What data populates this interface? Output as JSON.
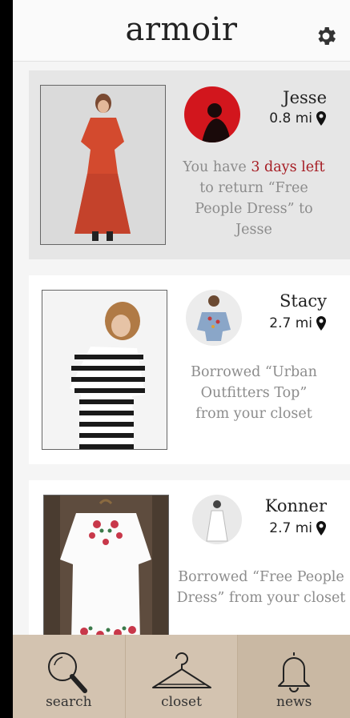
{
  "app": {
    "title": "armoir"
  },
  "feed": [
    {
      "name": "Jesse",
      "distance": "0.8 mi",
      "message_prefix": "You have ",
      "message_highlight": "3 days left",
      "message_suffix": " to return “Free People Dress” to Jesse"
    },
    {
      "name": "Stacy",
      "distance": "2.7 mi",
      "message": "Borrowed “Urban Outfitters Top” from your closet"
    },
    {
      "name": "Konner",
      "distance": "2.7 mi",
      "message": "Borrowed “Free People Dress” from your closet"
    }
  ],
  "tabs": [
    {
      "label": "search",
      "icon": "search-icon"
    },
    {
      "label": "closet",
      "icon": "hanger-icon"
    },
    {
      "label": "news",
      "icon": "bell-icon",
      "active": true
    }
  ],
  "colors": {
    "accent": "#a61d24",
    "tabbar": "#d3c3b0",
    "avatar_red": "#d2161d"
  }
}
